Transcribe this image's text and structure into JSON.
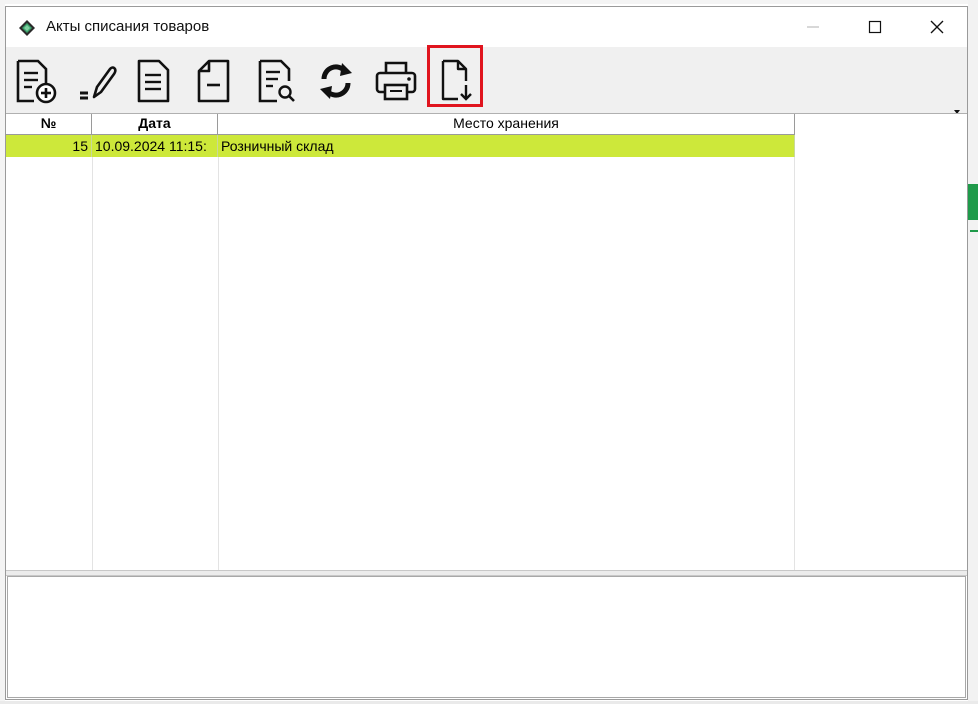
{
  "window": {
    "title": "Акты списания товаров",
    "icon": "diamond-app-icon",
    "controls": [
      "minimize-icon",
      "maximize-icon",
      "close-icon"
    ]
  },
  "toolbar": {
    "buttons": [
      {
        "name": "add-document-button",
        "icon": "document-add-icon"
      },
      {
        "name": "edit-button",
        "icon": "pencil-icon"
      },
      {
        "name": "open-document-button",
        "icon": "document-icon"
      },
      {
        "name": "delete-document-button",
        "icon": "document-minus-icon"
      },
      {
        "name": "preview-document-button",
        "icon": "document-search-icon"
      },
      {
        "name": "refresh-button",
        "icon": "refresh-icon"
      },
      {
        "name": "print-button",
        "icon": "printer-icon"
      },
      {
        "name": "export-document-button",
        "icon": "document-download-icon",
        "highlighted": true
      }
    ],
    "highlight_color": "#e0141e"
  },
  "table": {
    "columns": [
      "№",
      "Дата",
      "Место хранения"
    ],
    "rows": [
      {
        "num": "15",
        "date": "10.09.2024 11:15:",
        "place": "Розничный склад",
        "selected": true
      }
    ],
    "selected_row_color": "#cde83a"
  }
}
